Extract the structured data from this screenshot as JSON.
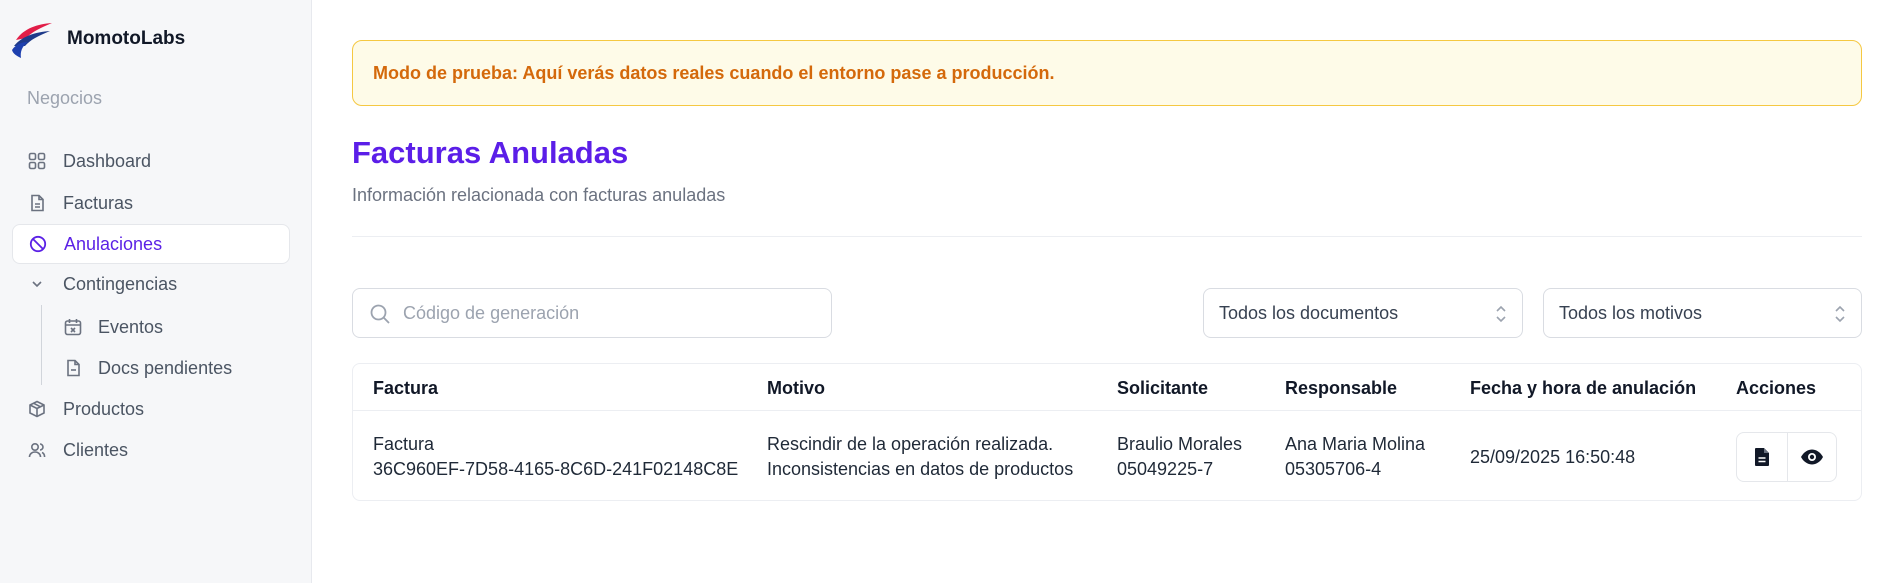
{
  "brand": {
    "name": "MomotoLabs"
  },
  "sidebar": {
    "section_label": "Negocios",
    "items": [
      {
        "label": "Dashboard",
        "icon": "grid-icon"
      },
      {
        "label": "Facturas",
        "icon": "file-text-icon"
      },
      {
        "label": "Anulaciones",
        "icon": "ban-icon",
        "active": true
      },
      {
        "label": "Contingencias",
        "icon": "chevron-down-icon",
        "expanded": true
      },
      {
        "label": "Eventos",
        "icon": "calendar-x-icon",
        "sub": true
      },
      {
        "label": "Docs pendientes",
        "icon": "file-minus-icon",
        "sub": true
      },
      {
        "label": "Productos",
        "icon": "package-icon"
      },
      {
        "label": "Clientes",
        "icon": "users-icon"
      }
    ]
  },
  "alert": {
    "text": "Modo de prueba: Aquí verás datos reales cuando el entorno pase a producción."
  },
  "page": {
    "title": "Facturas Anuladas",
    "subtitle": "Información relacionada con facturas anuladas"
  },
  "filters": {
    "search_placeholder": "Código de generación",
    "search_value": "",
    "documents_select": "Todos los documentos",
    "reasons_select": "Todos los motivos"
  },
  "table": {
    "headers": {
      "factura": "Factura",
      "motivo": "Motivo",
      "solicitante": "Solicitante",
      "responsable": "Responsable",
      "fecha": "Fecha y hora de anulación",
      "acciones": "Acciones"
    },
    "rows": [
      {
        "factura_type": "Factura",
        "factura_code": "36C960EF-7D58-4165-8C6D-241F02148C8E",
        "motivo_1": "Rescindir de la operación realizada.",
        "motivo_2": "Inconsistencias en datos de productos",
        "solicitante_name": "Braulio Morales",
        "solicitante_id": "05049225-7",
        "responsable_name": "Ana Maria Molina",
        "responsable_id": "05305706-4",
        "fecha": "25/09/2025 16:50:48"
      }
    ]
  },
  "colors": {
    "accent": "#5b1ee8",
    "alert_bg": "#fefbe8",
    "alert_border": "#f5c842",
    "alert_text": "#d4690b"
  }
}
